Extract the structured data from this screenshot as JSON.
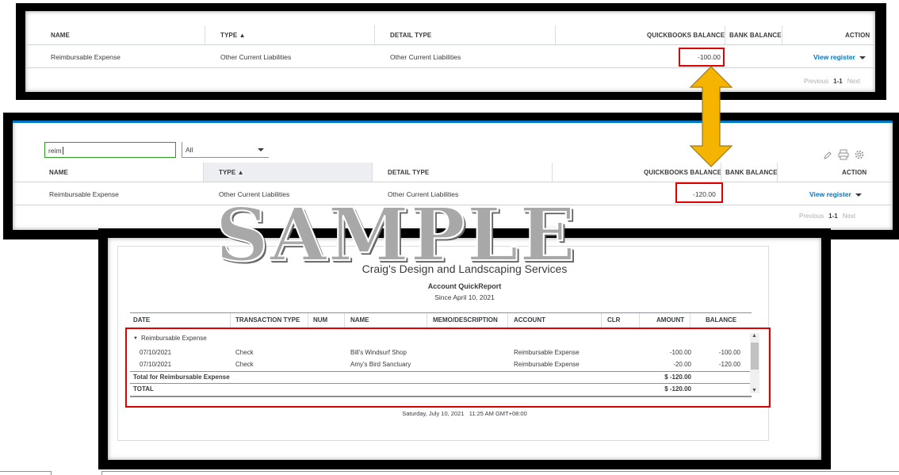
{
  "columns": {
    "name": "NAME",
    "type": "TYPE ▲",
    "detail_type": "DETAIL TYPE",
    "qb_balance": "QUICKBOOKS BALANCE",
    "bank_balance": "BANK BALANCE",
    "action": "ACTION"
  },
  "panel_top": {
    "row": {
      "name": "Reimbursable Expense",
      "type": "Other Current Liabilities",
      "detail_type": "Other Current Liabilities",
      "qb_balance": "-100.00",
      "action": "View register"
    },
    "pager": {
      "prev": "Previous",
      "range": "1-1",
      "next": "Next"
    }
  },
  "panel_middle": {
    "search_value": "reim",
    "filter_value": "All",
    "row": {
      "name": "Reimbursable Expense",
      "type": "Other Current Liabilities",
      "detail_type": "Other Current Liabilities",
      "qb_balance": "-120.00",
      "action": "View register"
    },
    "pager": {
      "prev": "Previous",
      "range": "1-1",
      "next": "Next"
    }
  },
  "report": {
    "company": "Craig's Design and Landscaping Services",
    "title": "Account QuickReport",
    "period": "Since April 10, 2021",
    "columns": [
      "DATE",
      "TRANSACTION TYPE",
      "NUM",
      "NAME",
      "MEMO/DESCRIPTION",
      "ACCOUNT",
      "CLR",
      "AMOUNT",
      "BALANCE"
    ],
    "group": "Reimbursable Expense",
    "rows": [
      {
        "date": "07/10/2021",
        "type": "Check",
        "name": "Bill's Windsurf Shop",
        "account": "Reimbursable Expense",
        "amount": "-100.00",
        "balance": "-100.00"
      },
      {
        "date": "07/10/2021",
        "type": "Check",
        "name": "Amy's Bird Sanctuary",
        "account": "Reimbursable Expense",
        "amount": "-20.00",
        "balance": "-120.00"
      }
    ],
    "total_label": "Total for Reimbursable Expense",
    "total_value": "$ -120.00",
    "grand_label": "TOTAL",
    "grand_value": "$ -120.00",
    "footer": "Saturday, July 10, 2021   11:25 AM GMT+08:00"
  },
  "watermark": "SAMPLE",
  "colors": {
    "link": "#0077c5",
    "highlight": "#e00000",
    "arrow": "#f4b400",
    "active_border": "#2ca01c"
  }
}
